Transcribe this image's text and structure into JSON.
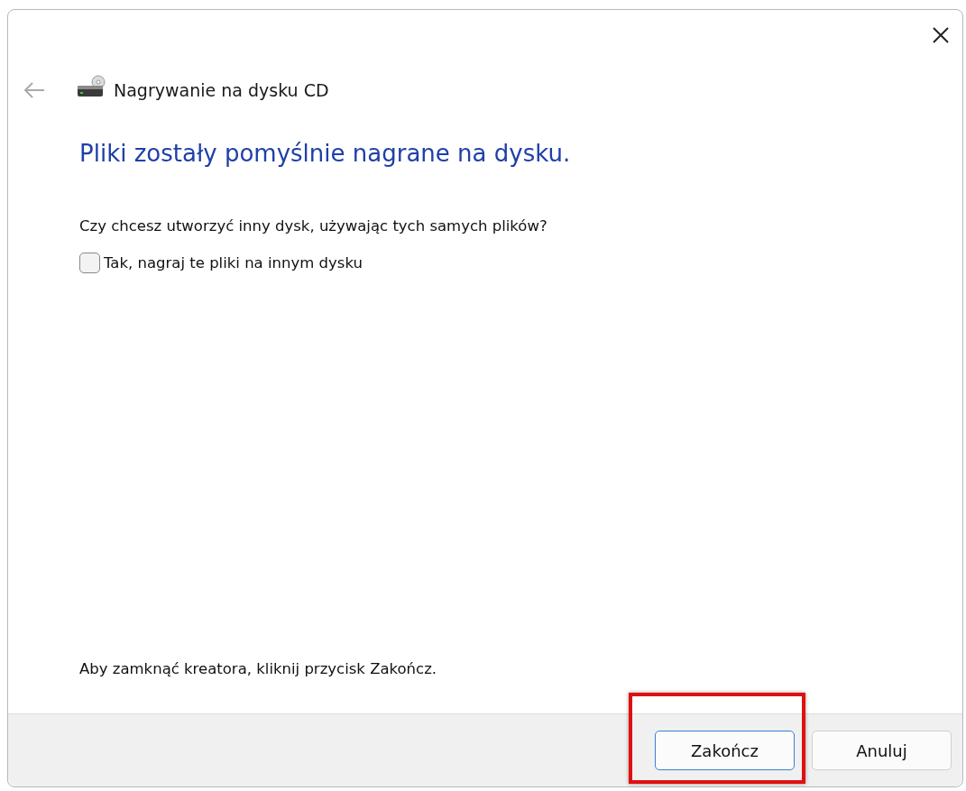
{
  "window": {
    "title": "Nagrywanie na dysku CD"
  },
  "heading": "Pliki zostały pomyślnie nagrane na dysku.",
  "question": "Czy chcesz utworzyć inny dysk, używając tych samych plików?",
  "checkbox": {
    "label": "Tak, nagraj te pliki na innym dysku",
    "checked": false
  },
  "hint": "Aby zamknąć kreatora, kliknij przycisk Zakończ.",
  "buttons": [
    {
      "label": "Zakończ",
      "highlighted": true
    },
    {
      "label": "Anuluj",
      "highlighted": false
    }
  ]
}
